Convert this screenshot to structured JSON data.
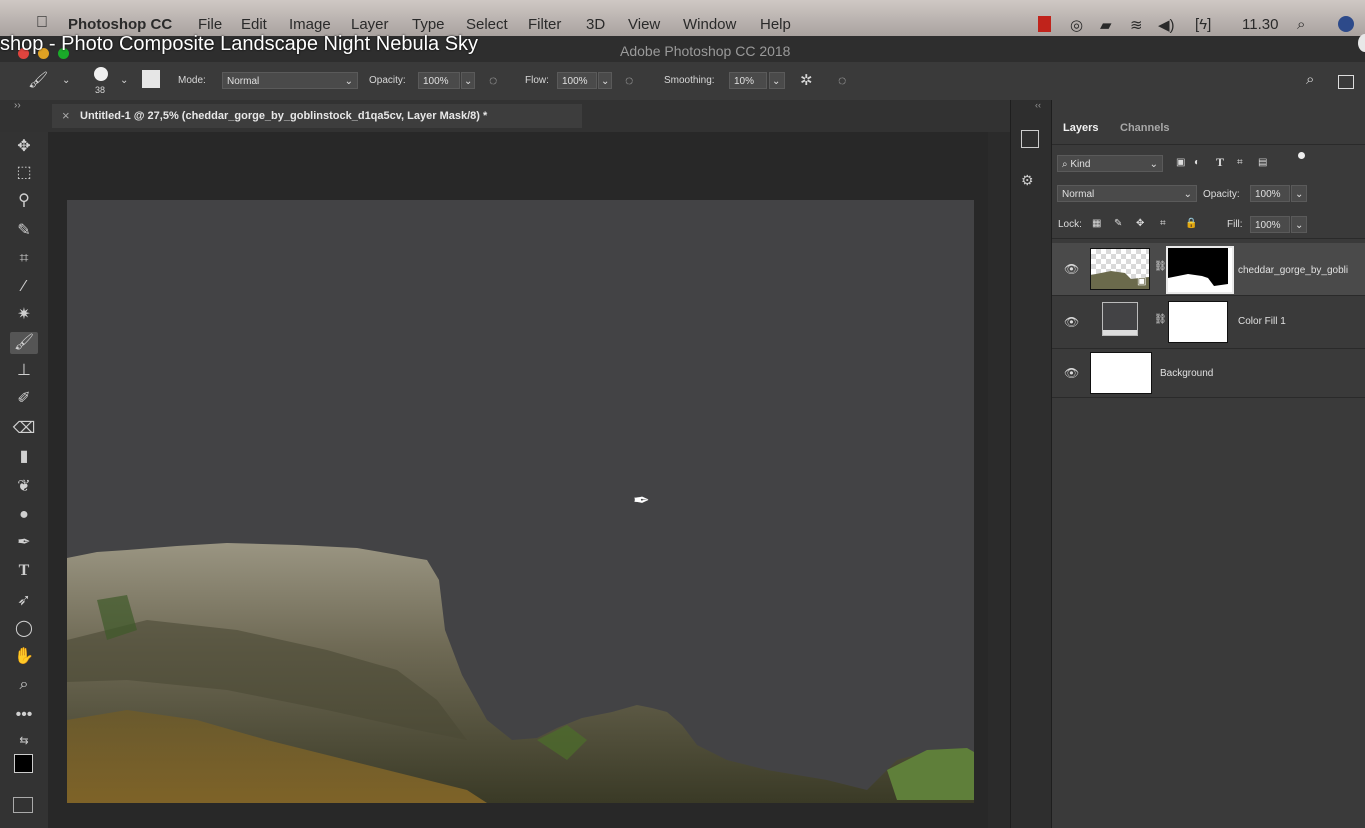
{
  "menubar": {
    "apple_icon": "",
    "app_name": "Photoshop CC",
    "items": [
      "File",
      "Edit",
      "Image",
      "Layer",
      "Type",
      "Select",
      "Filter",
      "3D",
      "View",
      "Window",
      "Help"
    ],
    "clock": "11.30"
  },
  "video_title": "shop - Photo Composite Landscape Night Nebula Sky",
  "window_title": "Adobe Photoshop CC 2018",
  "options": {
    "brush_size": "38",
    "mode_label": "Mode:",
    "mode_value": "Normal",
    "opacity_label": "Opacity:",
    "opacity_value": "100%",
    "flow_label": "Flow:",
    "flow_value": "100%",
    "smoothing_label": "Smoothing:",
    "smoothing_value": "10%"
  },
  "document_tab": "Untitled-1 @ 27,5% (cheddar_gorge_by_goblinstock_d1qa5cv, Layer Mask/8) *",
  "layers_panel": {
    "tabs": [
      "Layers",
      "Channels"
    ],
    "filter_kind": "Kind",
    "blend_mode": "Normal",
    "opacity_label": "Opacity:",
    "opacity_value": "100%",
    "lock_label": "Lock:",
    "fill_label": "Fill:",
    "fill_value": "100%",
    "layers": [
      {
        "name": "cheddar_gorge_by_gobli",
        "selected": true
      },
      {
        "name": "Color Fill 1",
        "selected": false
      },
      {
        "name": "Background",
        "selected": false
      }
    ]
  },
  "colors": {
    "canvas": "#434345",
    "selected_layer": "#4a4a4a"
  }
}
